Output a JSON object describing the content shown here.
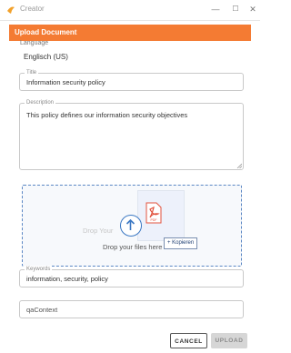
{
  "window": {
    "title": "Creator"
  },
  "dialog": {
    "title": "Upload Document"
  },
  "language": {
    "label": "Language",
    "value": "Englisch (US)"
  },
  "title_field": {
    "label": "Title",
    "value": "Information security policy"
  },
  "description_field": {
    "label": "Description",
    "value": "This policy defines our information security objectives"
  },
  "dropzone": {
    "ghost_text": "Drop Your",
    "text": "Drop your files here",
    "drag_file_type": "PDF",
    "copy_badge": "+ Kopieren"
  },
  "keywords_field": {
    "label": "Keywords",
    "value": "information, security, policy"
  },
  "context_field": {
    "value": "qaContext"
  },
  "buttons": {
    "cancel": "CANCEL",
    "upload": "UPLOAD"
  },
  "colors": {
    "accent": "#f47b33",
    "primary_blue": "#3b78c3",
    "pdf_red": "#e2533f"
  }
}
